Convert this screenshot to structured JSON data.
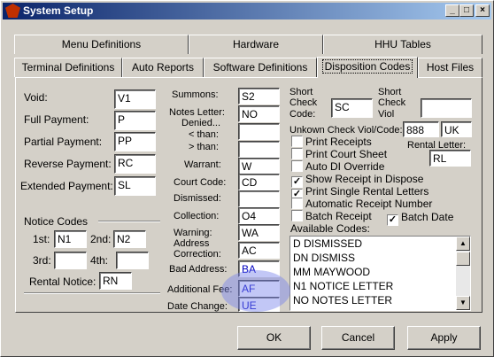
{
  "window": {
    "title": "System Setup",
    "min": "_",
    "max": "□",
    "close": "×"
  },
  "tabs_row1": [
    "Menu Definitions",
    "Hardware",
    "HHU Tables"
  ],
  "tabs_row2": [
    "Terminal Definitions",
    "Auto Reports",
    "Software Definitions",
    "Disposition Codes",
    "Host Files"
  ],
  "left": {
    "void": {
      "label": "Void:",
      "value": "V1"
    },
    "full_payment": {
      "label": "Full Payment:",
      "value": "P"
    },
    "partial_payment": {
      "label": "Partial Payment:",
      "value": "PP"
    },
    "reverse_payment": {
      "label": "Reverse Payment:",
      "value": "RC"
    },
    "extended_payment": {
      "label": "Extended Payment:",
      "value": "SL"
    },
    "notice_codes": "Notice Codes",
    "first": {
      "label": "1st:",
      "value": "N1"
    },
    "second": {
      "label": "2nd:",
      "value": "N2"
    },
    "third": {
      "label": "3rd:",
      "value": ""
    },
    "fourth": {
      "label": "4th:",
      "value": ""
    },
    "rental_notice": {
      "label": "Rental Notice:",
      "value": "RN"
    }
  },
  "middle": {
    "summons": {
      "label": "Summons:",
      "value": "S2"
    },
    "notes_letter": {
      "label": "Notes Letter:",
      "value": "NO"
    },
    "denied": "Denied...",
    "less_than": {
      "label": "< than:",
      "value": ""
    },
    "greater_than": {
      "label": "> than:",
      "value": ""
    },
    "warrant": {
      "label": "Warrant:",
      "value": "W"
    },
    "court_code": {
      "label": "Court Code:",
      "value": "CD"
    },
    "dismissed": {
      "label": "Dismissed:",
      "value": ""
    },
    "collection": {
      "label": "Collection:",
      "value": "O4"
    },
    "warning": {
      "label": "Warning:",
      "value": "WA"
    },
    "address_correction": {
      "label1": "Address",
      "label2": "Correction:",
      "value": "AC"
    },
    "bad_address": {
      "label": "Bad Address:",
      "value": "BA"
    },
    "additional_fee": {
      "label": "Additional Fee:",
      "value": "AF"
    },
    "date_change": {
      "label": "Date Change:",
      "value": "UE"
    }
  },
  "right": {
    "short_check_code": {
      "label1": "Short",
      "label2": "Check",
      "label3": "Code:",
      "value": "SC"
    },
    "short_check_viol": {
      "label1": "Short",
      "label2": "Check",
      "label3": "Viol",
      "value": ""
    },
    "unknown_check": {
      "label": "Unkown Check Viol/Code:",
      "viol": "888",
      "code": "UK"
    },
    "rental_letter": {
      "label": "Rental Letter:",
      "value": "RL"
    },
    "checkboxes": [
      {
        "label": "Print Receipts",
        "checked": false
      },
      {
        "label": "Print Court Sheet",
        "checked": false
      },
      {
        "label": "Auto DI Override",
        "checked": false
      },
      {
        "label": "Show Receipt in Dispose",
        "checked": true
      },
      {
        "label": "Print Single Rental Letters",
        "checked": true
      },
      {
        "label": "Automatic Receipt Number",
        "checked": false
      },
      {
        "label": "Batch Receipt",
        "checked": false
      },
      {
        "label": "Batch Date",
        "checked": true
      }
    ],
    "available_codes_label": "Available Codes:",
    "available_codes": [
      "D  DISMISSED",
      "DN DISMISS",
      "MM MAYWOOD",
      "N1 NOTICE LETTER",
      "NO NOTES LETTER"
    ]
  },
  "buttons": {
    "ok": "OK",
    "cancel": "Cancel",
    "apply": "Apply"
  },
  "colors": {
    "face": "#d4d0c8",
    "title_start": "#0a246a",
    "field_text_highlight": "#0000c0"
  }
}
